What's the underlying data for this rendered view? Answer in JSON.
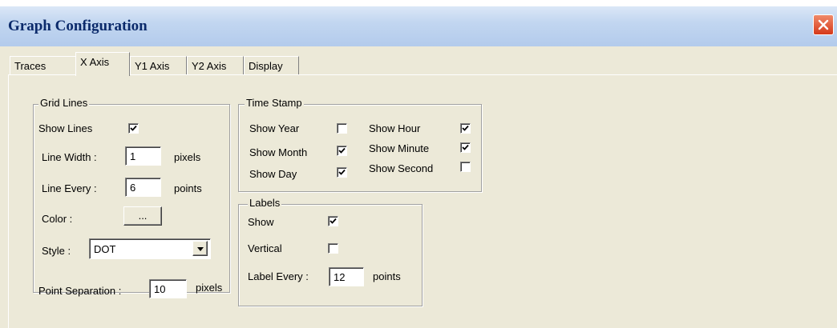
{
  "window": {
    "title": "Graph Configuration"
  },
  "tabs": {
    "traces": "Traces",
    "x_axis": "X Axis",
    "y1_axis": "Y1 Axis",
    "y2_axis": "Y2 Axis",
    "display": "Display",
    "active": "X Axis"
  },
  "grid_lines": {
    "legend": "Grid Lines",
    "show_lines_label": "Show Lines",
    "show_lines_checked": true,
    "line_width_label": "Line Width :",
    "line_width_value": "1",
    "line_width_unit": "pixels",
    "line_every_label": "Line Every :",
    "line_every_value": "6",
    "line_every_unit": "points",
    "color_label": "Color :",
    "color_button": "...",
    "style_label": "Style :",
    "style_value": "DOT"
  },
  "point_separation": {
    "label": "Point Separation :",
    "value": "10",
    "unit": "pixels"
  },
  "time_stamp": {
    "legend": "Time Stamp",
    "show_year": "Show Year",
    "show_year_checked": false,
    "show_month": "Show Month",
    "show_month_checked": true,
    "show_day": "Show Day",
    "show_day_checked": true,
    "show_hour": "Show Hour",
    "show_hour_checked": true,
    "show_minute": "Show Minute",
    "show_minute_checked": true,
    "show_second": "Show Second",
    "show_second_checked": false
  },
  "labels": {
    "legend": "Labels",
    "show": "Show",
    "show_checked": true,
    "vertical": "Vertical",
    "vertical_checked": false,
    "label_every_label": "Label Every :",
    "label_every_value": "12",
    "label_every_unit": "points"
  },
  "icons": {
    "close": "close-icon",
    "check": "checkmark-icon",
    "dropdown": "dropdown-arrow-icon"
  }
}
